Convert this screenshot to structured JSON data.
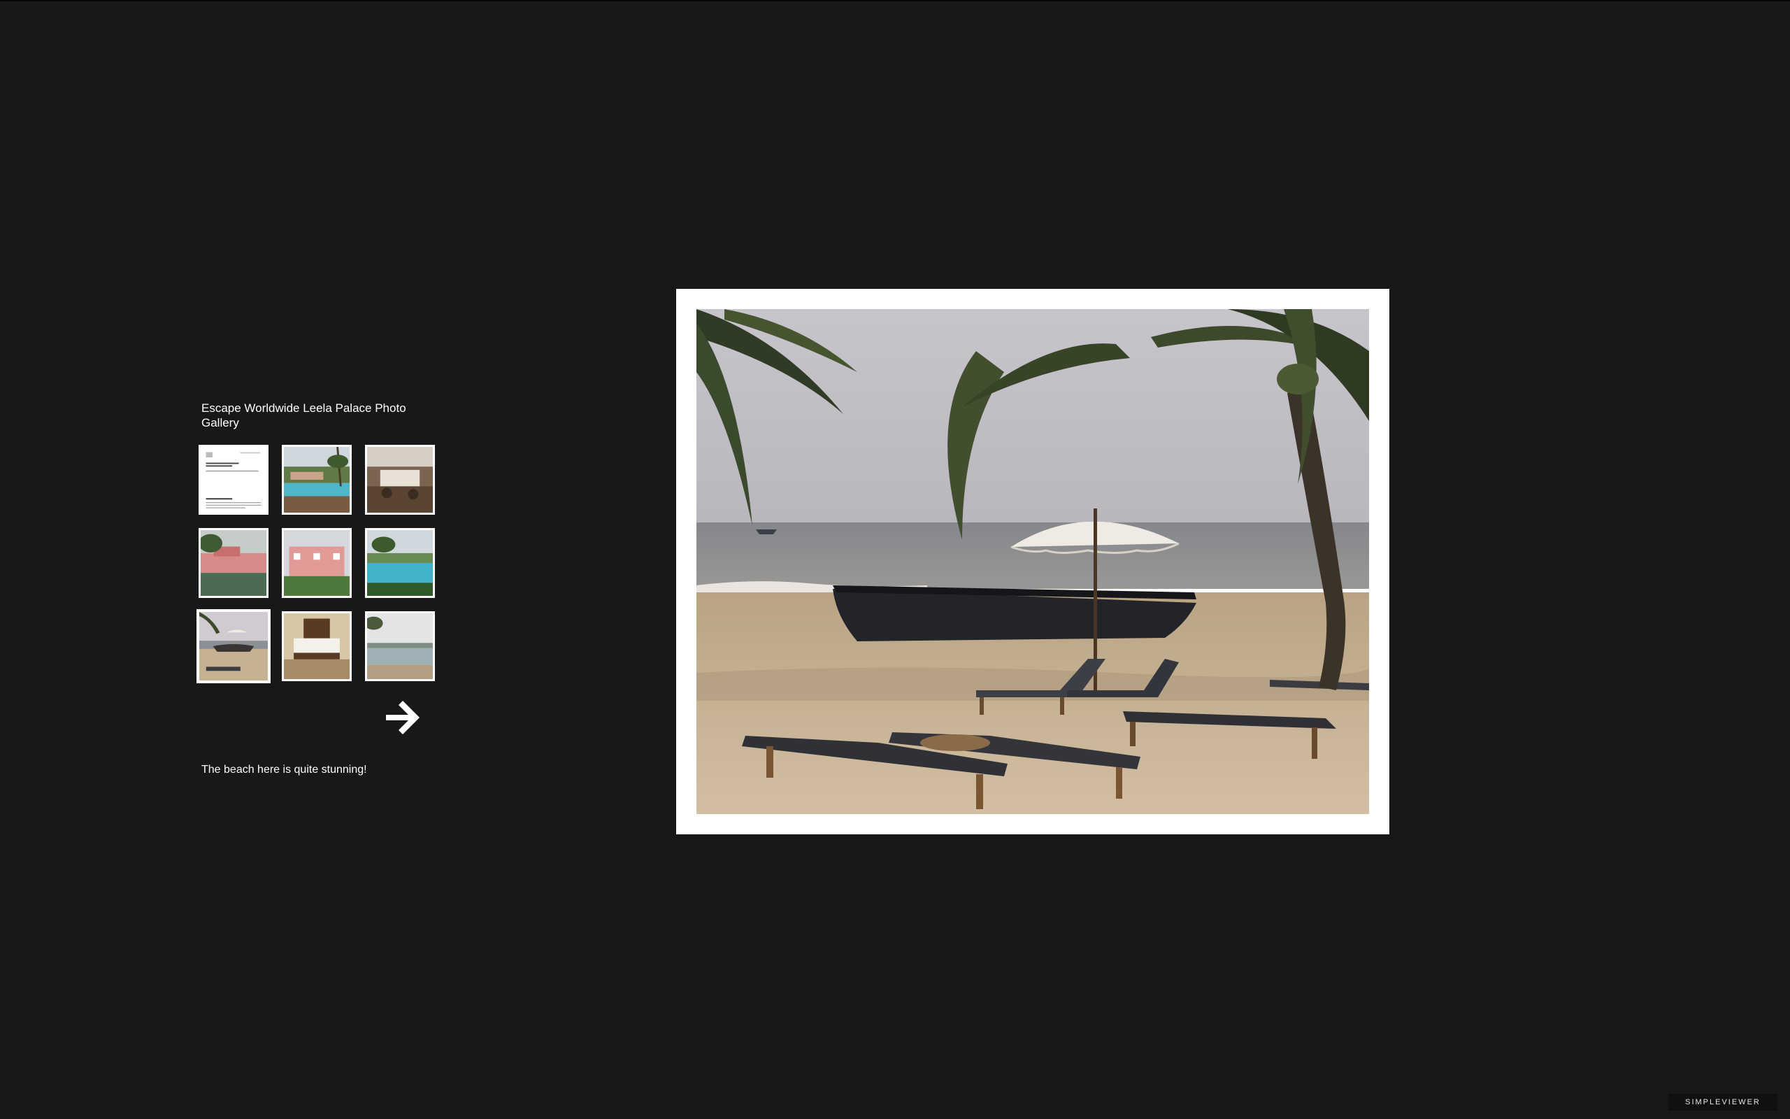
{
  "gallery": {
    "title": "Escape Worldwide Leela Palace Photo Gallery",
    "caption": "The beach here is quite stunning!",
    "selected_index": 6,
    "thumbnails": [
      {
        "name": "thumb-document",
        "icon": "document-thumb"
      },
      {
        "name": "thumb-resort-pool",
        "icon": "pool-thumb"
      },
      {
        "name": "thumb-restaurant",
        "icon": "restaurant-thumb"
      },
      {
        "name": "thumb-pink-villas",
        "icon": "villa-thumb"
      },
      {
        "name": "thumb-pink-villas-2",
        "icon": "villa-thumb"
      },
      {
        "name": "thumb-lagoon-pool",
        "icon": "pool-thumb"
      },
      {
        "name": "thumb-beach",
        "icon": "beach-thumb"
      },
      {
        "name": "thumb-bedroom",
        "icon": "bedroom-thumb"
      },
      {
        "name": "thumb-infinity-pool",
        "icon": "pool-thumb"
      }
    ],
    "next_icon": "arrow-right-icon"
  },
  "branding": {
    "label": "SimpleViewer"
  },
  "colors": {
    "background": "#181818",
    "frame": "#ffffff"
  }
}
